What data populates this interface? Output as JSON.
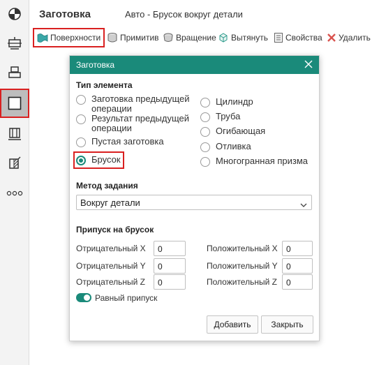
{
  "header": {
    "title": "Заготовка",
    "subtitle": "Авто - Брусок вокруг детали"
  },
  "toolbar": {
    "items": [
      {
        "label": "Поверхности",
        "icon": "surfaces-icon",
        "selected": true
      },
      {
        "label": "Примитив",
        "icon": "primitive-icon"
      },
      {
        "label": "Вращение",
        "icon": "rotation-icon"
      },
      {
        "label": "Вытянуть",
        "icon": "extrude-icon"
      },
      {
        "label": "Свойства",
        "icon": "properties-icon"
      },
      {
        "label": "Удалить",
        "icon": "delete-icon"
      }
    ]
  },
  "rail": {
    "items": [
      {
        "icon": "chart-pie-icon"
      },
      {
        "icon": "machine-icon"
      },
      {
        "icon": "stock-icon"
      },
      {
        "icon": "blank-square-icon",
        "active": true
      },
      {
        "icon": "fixture-icon"
      },
      {
        "icon": "section-icon"
      },
      {
        "icon": "more-icon"
      }
    ]
  },
  "dialog": {
    "title": "Заготовка",
    "element_type_label": "Тип элемента",
    "options_left": [
      "Заготовка предыдущей операции",
      "Результат предыдущей операции",
      "Пустая заготовка",
      "Брусок"
    ],
    "options_right": [
      "Цилиндр",
      "Труба",
      "Огибающая",
      "Отливка",
      "Многогранная призма"
    ],
    "selected_option": "Брусок",
    "method_label": "Метод задания",
    "method_value": "Вокруг детали",
    "allowance_label": "Припуск на брусок",
    "neg_x_label": "Отрицательный X",
    "neg_y_label": "Отрицательный Y",
    "neg_z_label": "Отрицательный Z",
    "pos_x_label": "Положительный X",
    "pos_y_label": "Положительный Y",
    "pos_z_label": "Положительный Z",
    "neg_x": "0",
    "neg_y": "0",
    "neg_z": "0",
    "pos_x": "0",
    "pos_y": "0",
    "pos_z": "0",
    "equal_allowance_label": "Равный припуск",
    "equal_allowance_on": true,
    "add_label": "Добавить",
    "close_label": "Закрыть"
  },
  "colors": {
    "accent": "#1a8a7a",
    "highlight": "#d92020"
  }
}
